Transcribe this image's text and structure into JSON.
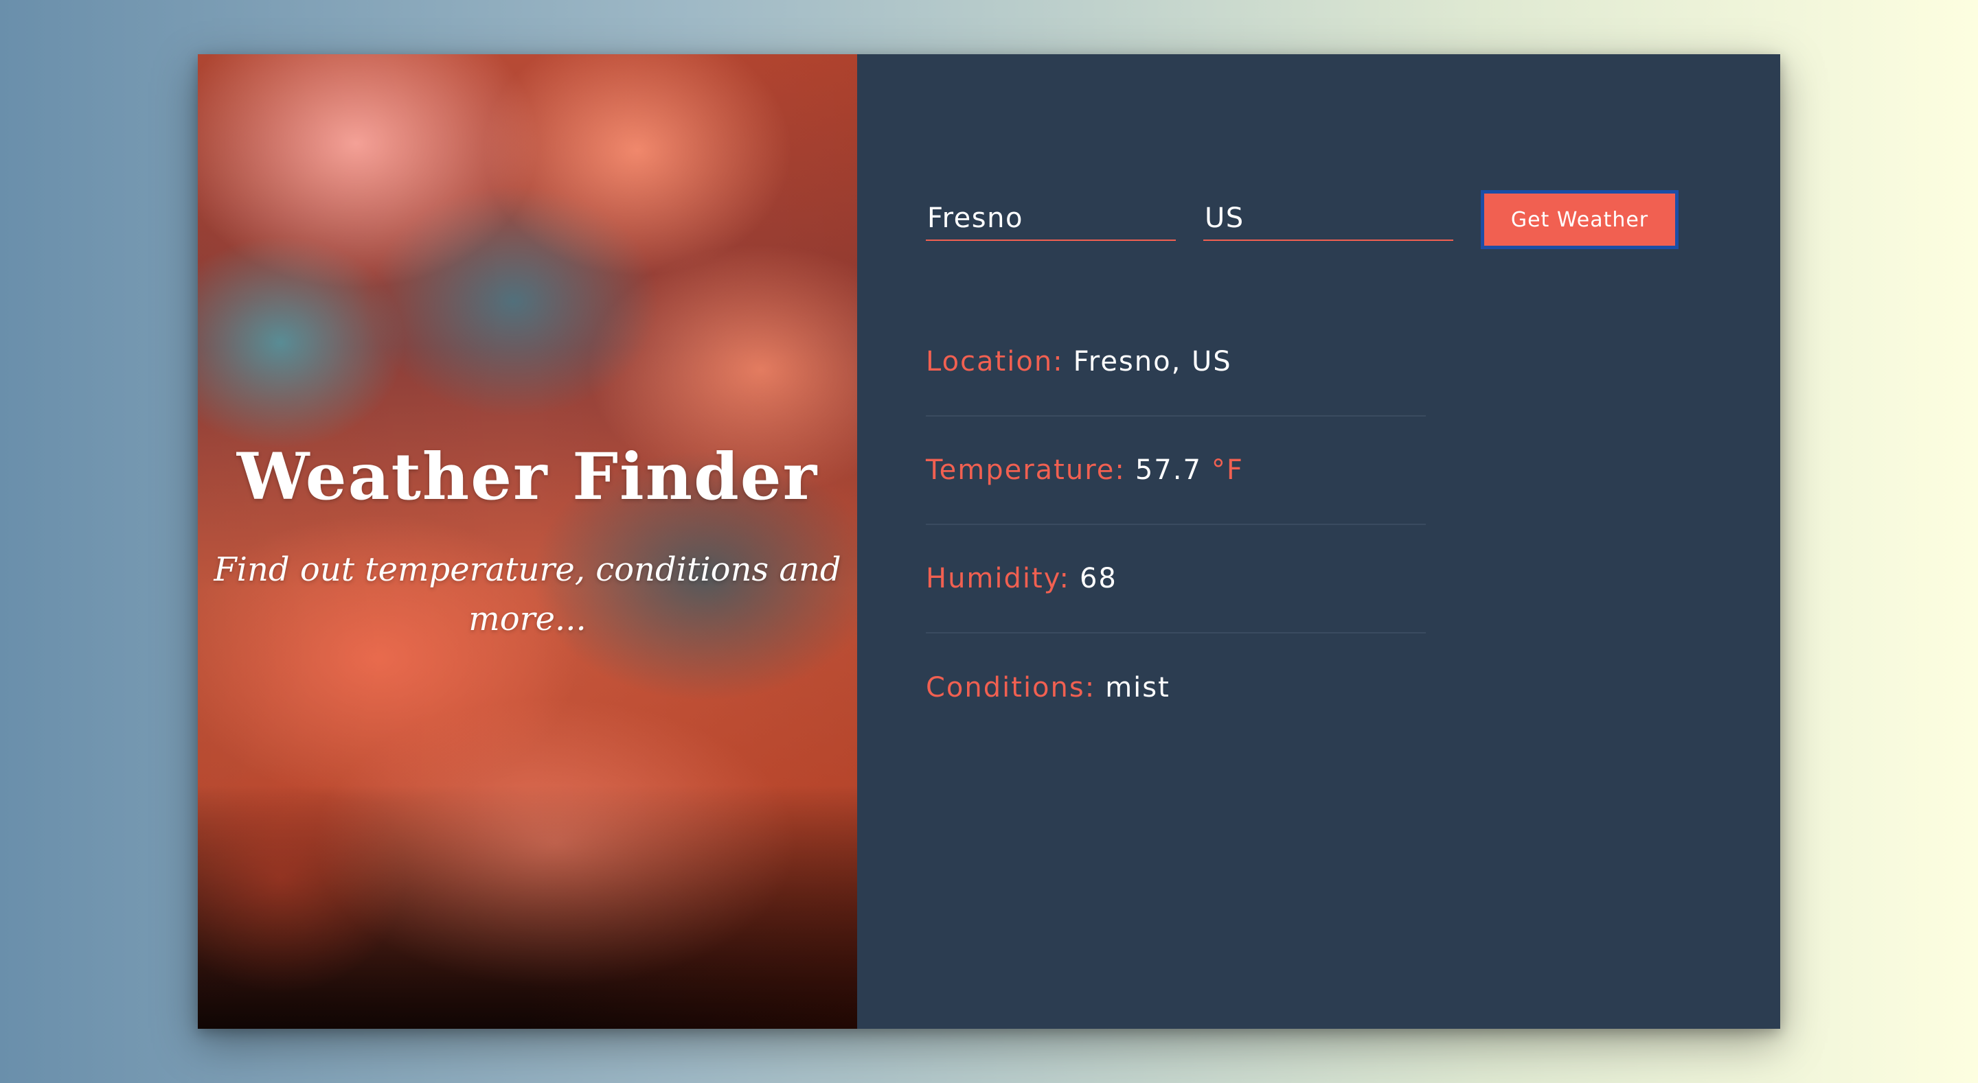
{
  "hero": {
    "title": "Weather Finder",
    "subtitle": "Find out temperature, conditions and more..."
  },
  "form": {
    "city_value": "Fresno",
    "country_value": "US",
    "submit_label": "Get Weather"
  },
  "results": {
    "location_label": "Location:",
    "location_value": "Fresno, US",
    "temperature_label": "Temperature:",
    "temperature_value": "57.7",
    "temperature_unit": "°F",
    "humidity_label": "Humidity:",
    "humidity_value": "68",
    "conditions_label": "Conditions:",
    "conditions_value": "mist"
  },
  "colors": {
    "accent": "#f16051",
    "panel_bg": "#2c3d51",
    "button_focus_border": "#1c4ea6"
  },
  "icons": {
    "hero_background": "clouds-photo"
  }
}
